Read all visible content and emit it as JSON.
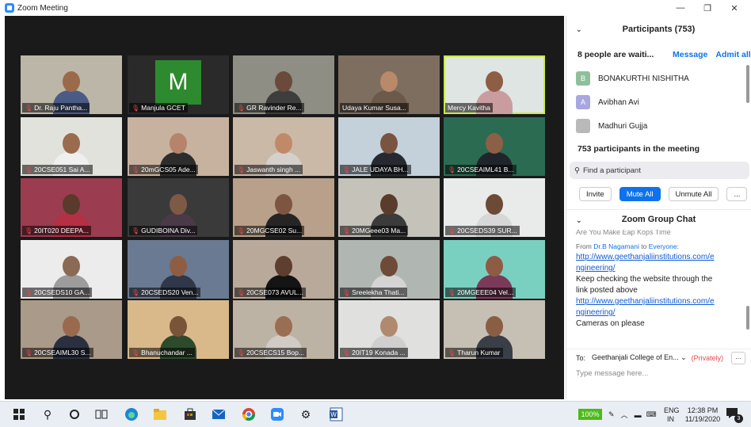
{
  "window": {
    "title": "Zoom Meeting",
    "minimize": "—",
    "restore": "❐",
    "close": "✕"
  },
  "tiles": [
    {
      "name": "Dr. Raju Panthа...",
      "muted": true,
      "bg": "#bcb6a8",
      "skin": "#9b6a4a",
      "shirt": "#4a5c86"
    },
    {
      "name": "Manjula GCET",
      "muted": true,
      "bg": "#2a2a2a",
      "initial": "M"
    },
    {
      "name": "GR Ravinder Re...",
      "muted": true,
      "bg": "#8e8e84",
      "skin": "#6a4a3a",
      "shirt": "#3d3d3d"
    },
    {
      "name": "Udaya Kumar Susa...",
      "muted": false,
      "bg": "#7e6e60",
      "skin": "#b88a6a",
      "shirt": "#6b5a4a"
    },
    {
      "name": "Mercy Kavitha",
      "muted": false,
      "bg": "#dfe5e2",
      "skin": "#8e5e44",
      "shirt": "#c99da0",
      "active": true
    },
    {
      "name": "20CSE051 Sai A...",
      "muted": true,
      "bg": "#e2e2dc",
      "skin": "#9a6b4e",
      "shirt": "#efefef"
    },
    {
      "name": "20mGCS05 Ade...",
      "muted": true,
      "bg": "#c7b2a0",
      "skin": "#b5846a",
      "shirt": "#2d2d2d"
    },
    {
      "name": "Jaswanth singh ...",
      "muted": true,
      "bg": "#c9b9a6",
      "skin": "#c08a6a",
      "shirt": "#d5d0cb"
    },
    {
      "name": "JALE UDAYA BH...",
      "muted": true,
      "bg": "#c4d1da",
      "skin": "#7a5440",
      "shirt": "#262a30"
    },
    {
      "name": "20CSEAIML41 B...",
      "muted": true,
      "bg": "#2b6b52",
      "skin": "#8b6046",
      "shirt": "#20252b"
    },
    {
      "name": "20IT020 DEEPA...",
      "muted": true,
      "bg": "#9c3c50",
      "skin": "#5a3a2a",
      "shirt": "#b52f45"
    },
    {
      "name": "GUDIBOINA Div...",
      "muted": true,
      "bg": "#3a3a3a",
      "skin": "#7d5a46",
      "shirt": "#4a3a48"
    },
    {
      "name": "20MGCSE02 Su...",
      "muted": true,
      "bg": "#b8a08a",
      "skin": "#7e5540",
      "shirt": "#252525"
    },
    {
      "name": "20MGeee03 Ma...",
      "muted": true,
      "bg": "#c5c2ba",
      "skin": "#5a3c2c",
      "shirt": "#3b3b3b"
    },
    {
      "name": "20CSEDS39 SUR...",
      "muted": true,
      "bg": "#e8ebe9",
      "skin": "#6d4a36",
      "shirt": "#d7d7d7"
    },
    {
      "name": "20CSEDS10 GA...",
      "muted": true,
      "bg": "#ececec",
      "skin": "#8a6a54",
      "shirt": "#9c9c9c"
    },
    {
      "name": "20CSEDS20 Ven...",
      "muted": true,
      "bg": "#6a7a92",
      "skin": "#8e5e44",
      "shirt": "#2f3848"
    },
    {
      "name": "20CSE073 AVUL...",
      "muted": true,
      "bg": "#b9a99a",
      "skin": "#5e3e2e",
      "shirt": "#141414"
    },
    {
      "name": "Sreelekha Thati...",
      "muted": true,
      "bg": "#b0b6b2",
      "skin": "#6e4a38",
      "shirt": "#d4d4d4"
    },
    {
      "name": "20MGEEE04 Vel...",
      "muted": true,
      "bg": "#7ad0c0",
      "skin": "#8e5c44",
      "shirt": "#7c3a5a"
    },
    {
      "name": "20CSEAIML30 S...",
      "muted": true,
      "bg": "#aa9a8a",
      "skin": "#9a6a4e",
      "shirt": "#2a3040"
    },
    {
      "name": "Bhanuchandar ...",
      "muted": true,
      "bg": "#d9b88a",
      "skin": "#7a5438",
      "shirt": "#2d4a2d"
    },
    {
      "name": "20CSECS15 Bop...",
      "muted": true,
      "bg": "#bdb3a4",
      "skin": "#9a6e52",
      "shirt": "#d0cbc4"
    },
    {
      "name": "20IT19 Konada ...",
      "muted": true,
      "bg": "#e0e0de",
      "skin": "#b08a6e",
      "shirt": "#cfcfcf"
    },
    {
      "name": "Tharun Kumar",
      "muted": true,
      "bg": "#c6bfb3",
      "skin": "#8a5e42",
      "shirt": "#3a3e46"
    }
  ],
  "participants": {
    "header": "Participants (753)",
    "waiting_text": "8 people are waiti...",
    "message_link": "Message",
    "admit_all": "Admit all",
    "waiting_list": [
      {
        "initial": "B",
        "name": "BONAKURTHI NISHITHA",
        "color": "#8fbf9a"
      },
      {
        "initial": "A",
        "name": "Avibhan Avi",
        "color": "#a8a7e0"
      },
      {
        "initial": "",
        "name": "Madhuri Gujja",
        "color": "#b9b9b9"
      }
    ],
    "count_text": "753 participants in the meeting",
    "search_placeholder": "Find a participant",
    "buttons": {
      "invite": "Invite",
      "mute_all": "Mute All",
      "unmute_all": "Unmute All",
      "more": "..."
    }
  },
  "chat": {
    "header": "Zoom Group Chat",
    "cutoff_text": "Are You Make Eap Kops Time",
    "from_name": "Dr.B Nagamani",
    "from_to": "to",
    "to_name": "Everyone",
    "colon": ":",
    "url1a": "http://www.geethanjaliinstitutions.com/e",
    "url1b": "ngineering/",
    "message1": "Keep checking the website through the",
    "message2": "link posted above",
    "url2a": "http://www.geethanjaliinstitutions.com/e",
    "url2b": "ngineering/",
    "message3": "Cameras on please",
    "to_label": "To:",
    "to_value": "Geethanjali College of En... ⌄",
    "privately": "(Privately)",
    "more": "···",
    "input_placeholder": "Type message here..."
  },
  "taskbar": {
    "icons": [
      "windows-icon",
      "search-icon",
      "cortana-icon",
      "task-view-icon",
      "edge-icon",
      "file-explorer-icon",
      "store-icon",
      "mail-icon",
      "chrome-icon",
      "zoom-icon",
      "settings-icon",
      "word-icon"
    ],
    "battery": "100%",
    "lang1": "ENG",
    "lang2": "IN",
    "time": "12:38 PM",
    "date": "11/19/2020",
    "notifications": "3"
  }
}
